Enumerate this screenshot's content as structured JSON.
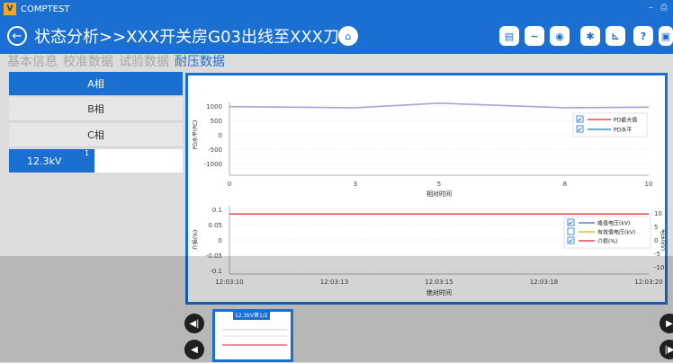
{
  "app": {
    "name": "COMPTEST",
    "title": "状态分析>>XXX开关房G03出线至XXX刀..."
  },
  "window_controls": [
    "–",
    "⎙"
  ],
  "toolbar_icons": [
    "clipboard-icon",
    "trend-icon",
    "camera-icon",
    "gear-icon",
    "chart-icon",
    "help-icon",
    "exit-icon"
  ],
  "toolbar_glyphs": [
    "▤",
    "∼",
    "◉",
    "✱",
    "⊾",
    "?",
    "▣"
  ],
  "tabs": [
    "基本信息",
    "校准数据",
    "试验数据",
    "耐压数据"
  ],
  "phases": [
    "A相",
    "B相",
    "C相"
  ],
  "voltage_item": {
    "label": "12.3kV",
    "badge": "1"
  },
  "thumbnail": {
    "label": "12.3kV第1/2"
  },
  "colors": {
    "accent": "#1a6fd0",
    "pd_max": "#d62728",
    "pd_level": "#1f77b4",
    "peak_voltage": "#4a5fc1",
    "effective_voltage": "#f0a500",
    "dielectric_loss": "#d62728"
  },
  "chart_data": [
    {
      "type": "line",
      "ylabel": "PD水平(PC)",
      "xlabel": "相对时间",
      "xlim": [
        0,
        10
      ],
      "ylim": [
        -1000,
        1000
      ],
      "xticks": [
        "0",
        "3",
        "5",
        "8",
        "10"
      ],
      "yticks": [
        "1000",
        "500",
        "0",
        "-500",
        "-1000"
      ],
      "series": [
        {
          "name": "PD最大值",
          "checked": true,
          "x": [
            0,
            3,
            5,
            8,
            10
          ],
          "values": [
            990,
            950,
            1110,
            950,
            970
          ]
        },
        {
          "name": "PD水平",
          "checked": true,
          "x": [
            0,
            3,
            5,
            8,
            10
          ],
          "values": [
            970,
            930,
            1090,
            930,
            950
          ]
        }
      ]
    },
    {
      "type": "line",
      "ylabel": "介损(%)",
      "y2label": "电压(kV)",
      "xlabel": "绝对时间",
      "ylim": [
        -0.1,
        0.1
      ],
      "y2lim": [
        -10,
        10
      ],
      "xticks": [
        "12:03:10",
        "12:03:13",
        "12:03:15",
        "12:03:18",
        "12:03:20"
      ],
      "yticks": [
        "0.1",
        "0.05",
        "0",
        "-0.05",
        "-0.1"
      ],
      "y2ticks": [
        "10",
        "5",
        "0",
        "-5",
        "-10"
      ],
      "series": [
        {
          "name": "峰值电压(kV)",
          "checked": true,
          "values": [
            null,
            null,
            null,
            null,
            null
          ]
        },
        {
          "name": "有效值电压(kV)",
          "checked": false,
          "values": [
            null,
            null,
            null,
            null,
            null
          ]
        },
        {
          "name": "介损(%)",
          "checked": true,
          "values": [
            0.085,
            0.085,
            0.085,
            0.085,
            0.085
          ]
        }
      ]
    }
  ]
}
